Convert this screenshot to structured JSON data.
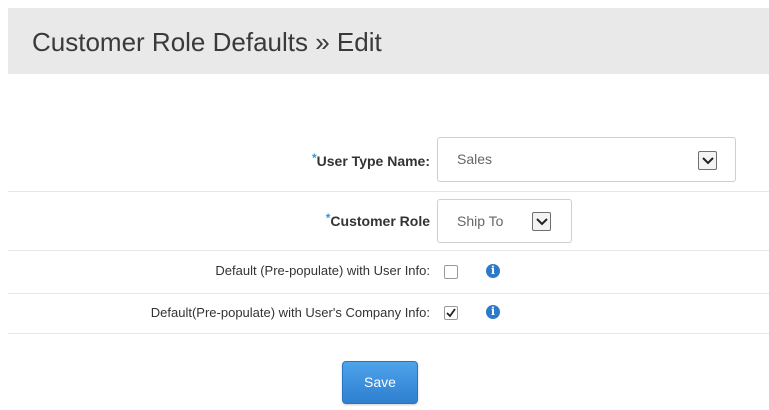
{
  "header": {
    "title": "Customer Role Defaults » Edit"
  },
  "form": {
    "user_type": {
      "required_mark": "*",
      "label": "User Type Name:",
      "value": "Sales"
    },
    "customer_role": {
      "required_mark": "*",
      "label": "Customer Role",
      "value": "Ship To"
    },
    "default_user_info": {
      "label": "Default (Pre-populate) with User Info:",
      "checked": false,
      "info_icon": "info-icon"
    },
    "default_company_info": {
      "label": "Default(Pre-populate) with User's Company Info:",
      "checked": true,
      "info_icon": "info-icon"
    }
  },
  "actions": {
    "save_label": "Save"
  },
  "colors": {
    "accent": "#2f7ac8",
    "required": "#2a9ad6",
    "header_bg": "#e9e9e9"
  }
}
